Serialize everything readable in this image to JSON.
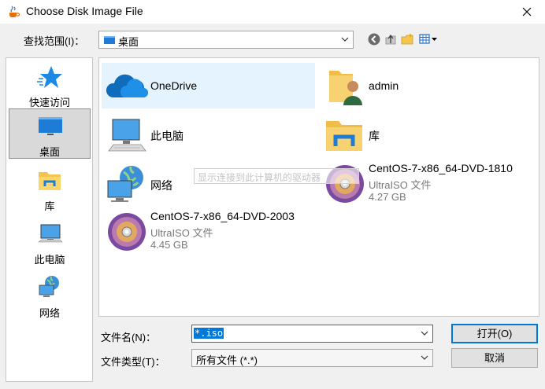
{
  "window": {
    "title": "Choose Disk Image File"
  },
  "lookin": {
    "label": "查找范围(I)：",
    "value": "桌面"
  },
  "places": [
    {
      "label": "快速访问",
      "icon": "star-icon"
    },
    {
      "label": "桌面",
      "icon": "desktop-icon",
      "selected": true
    },
    {
      "label": "库",
      "icon": "library-icon"
    },
    {
      "label": "此电脑",
      "icon": "computer-icon"
    },
    {
      "label": "网络",
      "icon": "network-icon"
    }
  ],
  "files": [
    {
      "name": "OneDrive",
      "icon": "onedrive-icon",
      "selected": true
    },
    {
      "name": "admin",
      "icon": "user-folder-icon"
    },
    {
      "name": "此电脑",
      "icon": "computer-icon"
    },
    {
      "name": "库",
      "icon": "library-icon"
    },
    {
      "name": "网络",
      "icon": "network-icon"
    },
    {
      "name": "CentOS-7-x86_64-DVD-1810",
      "type": "UltraISO 文件",
      "size": "4.27 GB",
      "icon": "disc-icon"
    },
    {
      "name": "CentOS-7-x86_64-DVD-2003",
      "type": "UltraISO 文件",
      "size": "4.45 GB",
      "icon": "disc-icon"
    }
  ],
  "tooltip": "显示连接到此计算机的驱动器",
  "filename": {
    "label": "文件名(N)：",
    "value": "*.iso"
  },
  "filetype": {
    "label": "文件类型(T)：",
    "value": "所有文件 (*.*)"
  },
  "buttons": {
    "open": "打开(O)",
    "cancel": "取消"
  },
  "colors": {
    "accent": "#0078d7",
    "selection": "#e5f3ff"
  }
}
